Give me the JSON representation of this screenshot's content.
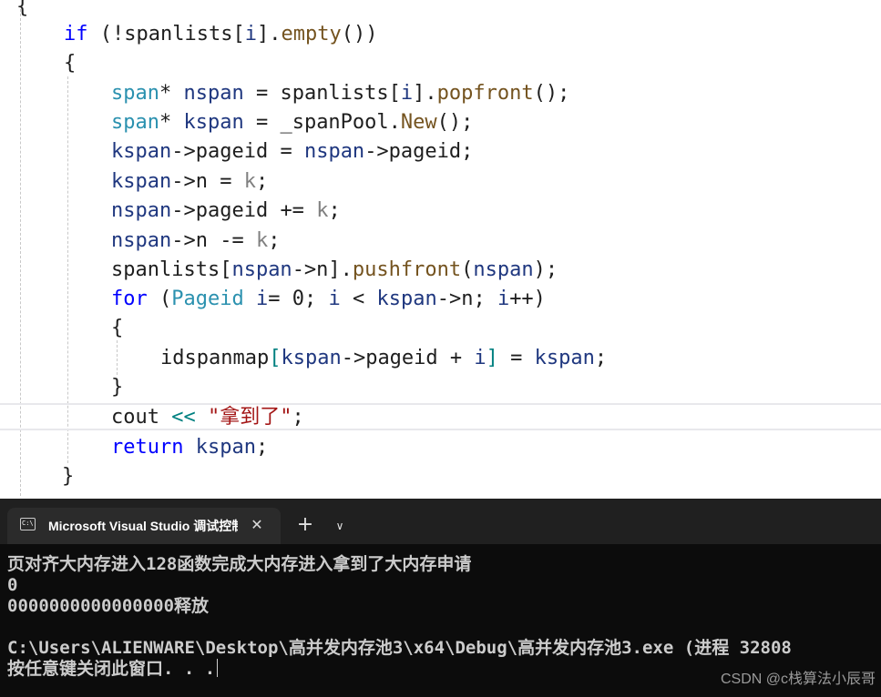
{
  "editor": {
    "lines": [
      [
        {
          "t": "{",
          "c": "pl"
        }
      ],
      [
        {
          "t": "if",
          "c": "kw"
        },
        {
          "t": " (!",
          "c": "pl"
        },
        {
          "t": "spanlists",
          "c": "pl"
        },
        {
          "t": "[",
          "c": "pl"
        },
        {
          "t": "i",
          "c": "lv"
        },
        {
          "t": "].",
          "c": "pl"
        },
        {
          "t": "empty",
          "c": "fn"
        },
        {
          "t": "())",
          "c": "pl"
        }
      ],
      [
        {
          "t": "{",
          "c": "pl"
        }
      ],
      [
        {
          "t": "span",
          "c": "ty"
        },
        {
          "t": "* ",
          "c": "pl"
        },
        {
          "t": "nspan",
          "c": "lv"
        },
        {
          "t": " = spanlists[",
          "c": "pl"
        },
        {
          "t": "i",
          "c": "lv"
        },
        {
          "t": "].",
          "c": "pl"
        },
        {
          "t": "popfront",
          "c": "fn"
        },
        {
          "t": "();",
          "c": "pl"
        }
      ],
      [
        {
          "t": "span",
          "c": "ty"
        },
        {
          "t": "* ",
          "c": "pl"
        },
        {
          "t": "kspan",
          "c": "lv"
        },
        {
          "t": " = _spanPool.",
          "c": "pl"
        },
        {
          "t": "New",
          "c": "fn"
        },
        {
          "t": "();",
          "c": "pl"
        }
      ],
      [
        {
          "t": "kspan",
          "c": "lv"
        },
        {
          "t": "->",
          "c": "pl"
        },
        {
          "t": "pageid = ",
          "c": "pl"
        },
        {
          "t": "nspan",
          "c": "lv"
        },
        {
          "t": "->pageid;",
          "c": "pl"
        }
      ],
      [
        {
          "t": "kspan",
          "c": "lv"
        },
        {
          "t": "->n = ",
          "c": "pl"
        },
        {
          "t": "k",
          "c": "pm"
        },
        {
          "t": ";",
          "c": "pl"
        }
      ],
      [
        {
          "t": "nspan",
          "c": "lv"
        },
        {
          "t": "->pageid += ",
          "c": "pl"
        },
        {
          "t": "k",
          "c": "pm"
        },
        {
          "t": ";",
          "c": "pl"
        }
      ],
      [
        {
          "t": "nspan",
          "c": "lv"
        },
        {
          "t": "->n -= ",
          "c": "pl"
        },
        {
          "t": "k",
          "c": "pm"
        },
        {
          "t": ";",
          "c": "pl"
        }
      ],
      [
        {
          "t": "spanlists[",
          "c": "pl"
        },
        {
          "t": "nspan",
          "c": "lv"
        },
        {
          "t": "->n].",
          "c": "pl"
        },
        {
          "t": "pushfront",
          "c": "fn"
        },
        {
          "t": "(",
          "c": "pl"
        },
        {
          "t": "nspan",
          "c": "lv"
        },
        {
          "t": ");",
          "c": "pl"
        }
      ],
      [
        {
          "t": "for",
          "c": "kw"
        },
        {
          "t": " (",
          "c": "pl"
        },
        {
          "t": "Pageid",
          "c": "ty"
        },
        {
          "t": " ",
          "c": "pl"
        },
        {
          "t": "i",
          "c": "lv"
        },
        {
          "t": "= 0; ",
          "c": "pl"
        },
        {
          "t": "i",
          "c": "lv"
        },
        {
          "t": " < ",
          "c": "pl"
        },
        {
          "t": "kspan",
          "c": "lv"
        },
        {
          "t": "->n; ",
          "c": "pl"
        },
        {
          "t": "i",
          "c": "lv"
        },
        {
          "t": "++)",
          "c": "pl"
        }
      ],
      [
        {
          "t": "{",
          "c": "pl"
        }
      ],
      [
        {
          "t": "idspanmap",
          "c": "pl"
        },
        {
          "t": "[",
          "c": "op"
        },
        {
          "t": "kspan",
          "c": "lv"
        },
        {
          "t": "->pageid + ",
          "c": "pl"
        },
        {
          "t": "i",
          "c": "lv"
        },
        {
          "t": "]",
          "c": "op"
        },
        {
          "t": " = ",
          "c": "pl"
        },
        {
          "t": "kspan",
          "c": "lv"
        },
        {
          "t": ";",
          "c": "pl"
        }
      ],
      [
        {
          "t": "}",
          "c": "pl"
        }
      ],
      [
        {
          "t": "cout ",
          "c": "pl"
        },
        {
          "t": "<<",
          "c": "op"
        },
        {
          "t": " ",
          "c": "pl"
        },
        {
          "t": "\"拿到了\"",
          "c": "st"
        },
        {
          "t": ";",
          "c": "pl"
        }
      ],
      [
        {
          "t": "return",
          "c": "kw"
        },
        {
          "t": " ",
          "c": "pl"
        },
        {
          "t": "kspan",
          "c": "lv"
        },
        {
          "t": ";",
          "c": "pl"
        }
      ],
      [
        {
          "t": "}",
          "c": "pl"
        }
      ]
    ]
  },
  "terminal": {
    "tab_title": "Microsoft Visual Studio 调试控制台",
    "tab_icon": "console-icon",
    "close_glyph": "✕",
    "new_tab_glyph": "+",
    "dropdown_glyph": "∨",
    "output": [
      "页对齐大内存进入128函数完成大内存进入拿到了大内存申请",
      "0",
      "0000000000000000释放",
      "",
      "C:\\Users\\ALIENWARE\\Desktop\\高并发内存池3\\x64\\Debug\\高并发内存池3.exe (进程 32808",
      "按任意键关闭此窗口. . ."
    ],
    "watermark": "CSDN @c栈算法小辰哥"
  }
}
